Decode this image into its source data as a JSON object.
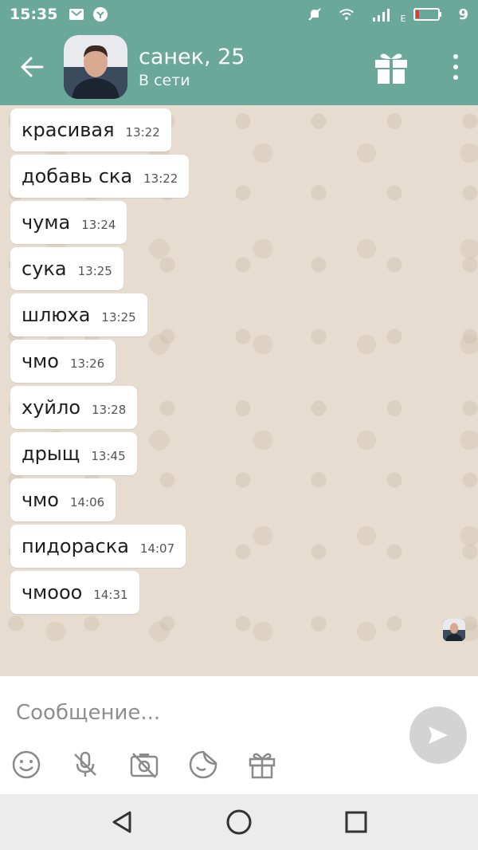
{
  "status_bar": {
    "time": "15:35",
    "network_label": "E",
    "battery_level": "9"
  },
  "header": {
    "contact_name": "санек, 25",
    "contact_status": "В сети"
  },
  "messages": [
    {
      "text": "красивая",
      "time": "13:22"
    },
    {
      "text": "добавь ска",
      "time": "13:22"
    },
    {
      "text": "чума",
      "time": "13:24"
    },
    {
      "text": "сука",
      "time": "13:25"
    },
    {
      "text": "шлюха",
      "time": "13:25"
    },
    {
      "text": "чмо",
      "time": "13:26"
    },
    {
      "text": "хуйло",
      "time": "13:28"
    },
    {
      "text": "дрыщ",
      "time": "13:45"
    },
    {
      "text": "чмо",
      "time": "14:06"
    },
    {
      "text": "пидораска",
      "time": "14:07"
    },
    {
      "text": "чмооо",
      "time": "14:31"
    }
  ],
  "composer": {
    "placeholder": "Сообщение..."
  },
  "colors": {
    "accent": "#6aa89a",
    "chat_background": "#e6dccf",
    "bubble": "#ffffff",
    "send_button": "#d3d3d3"
  }
}
